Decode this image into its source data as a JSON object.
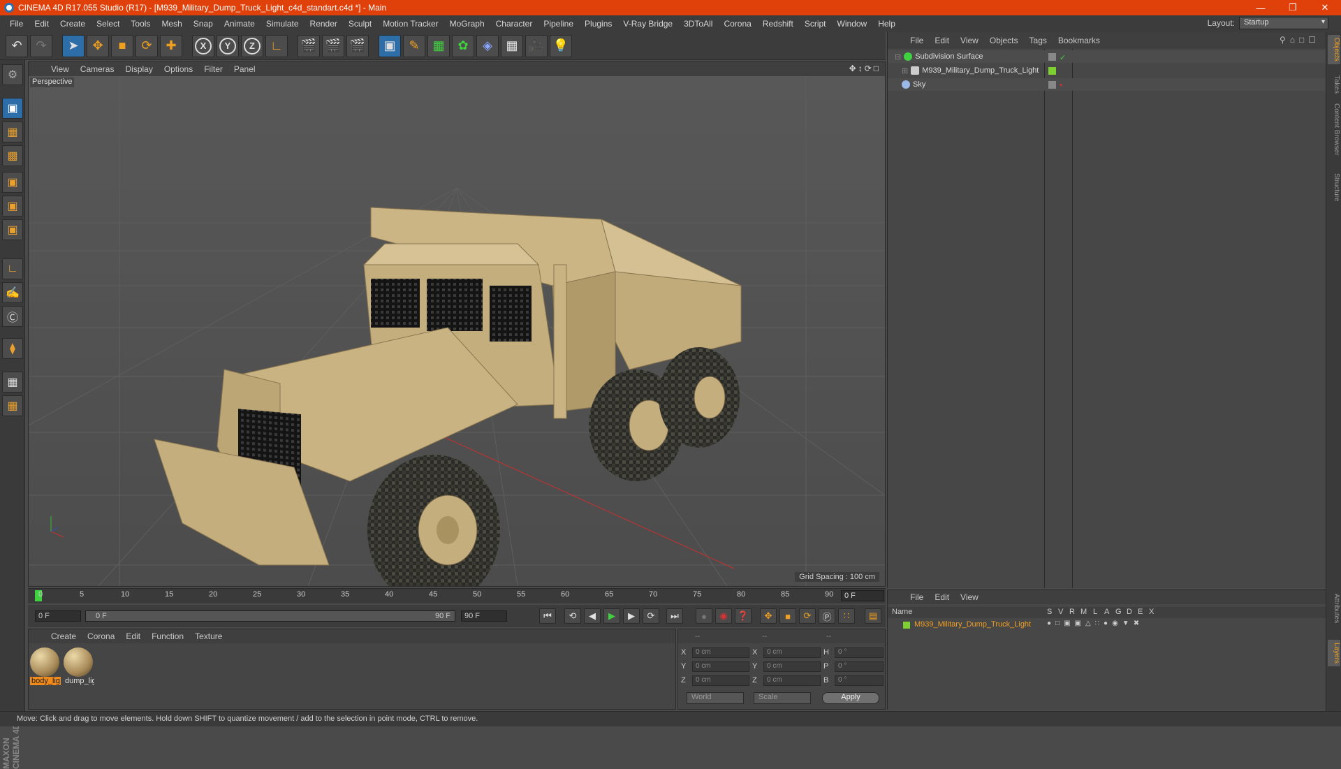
{
  "window": {
    "title": "CINEMA 4D R17.055 Studio (R17) - [M939_Military_Dump_Truck_Light_c4d_standart.c4d *] - Main",
    "minimize_icon": "minimize-icon",
    "restore_icon": "restore-icon",
    "close_icon": "close-icon"
  },
  "menubar": {
    "items": [
      "File",
      "Edit",
      "Create",
      "Select",
      "Tools",
      "Mesh",
      "Snap",
      "Animate",
      "Simulate",
      "Render",
      "Sculpt",
      "Motion Tracker",
      "MoGraph",
      "Character",
      "Pipeline",
      "Plugins",
      "V-Ray Bridge",
      "3DToAll",
      "Corona",
      "Redshift",
      "Script",
      "Window",
      "Help"
    ],
    "layout_label": "Layout:",
    "layout_value": "Startup"
  },
  "viewport": {
    "menu": [
      "View",
      "Cameras",
      "Display",
      "Options",
      "Filter",
      "Panel"
    ],
    "label": "Perspective",
    "grid_spacing": "Grid Spacing : 100 cm",
    "object_color": "#c9b382"
  },
  "timeline": {
    "ticks": [
      "0",
      "5",
      "10",
      "15",
      "20",
      "25",
      "30",
      "35",
      "40",
      "45",
      "50",
      "55",
      "60",
      "65",
      "70",
      "75",
      "80",
      "85",
      "90"
    ],
    "current_frame": "0 F"
  },
  "playbar": {
    "start_frame": "0 F",
    "range_start": "0 F",
    "range_end": "90 F",
    "end_frame": "90 F"
  },
  "material_manager": {
    "menu": [
      "Create",
      "Corona",
      "Edit",
      "Function",
      "Texture"
    ],
    "materials": [
      {
        "label": "body_lig"
      },
      {
        "label": "dump_lig"
      }
    ]
  },
  "coordinates": {
    "header": [
      "--",
      "--",
      "--"
    ],
    "rows": [
      {
        "a1": "X",
        "v1": "0 cm",
        "a2": "X",
        "v2": "0 cm",
        "a3": "H",
        "v3": "0 °"
      },
      {
        "a1": "Y",
        "v1": "0 cm",
        "a2": "Y",
        "v2": "0 cm",
        "a3": "P",
        "v3": "0 °"
      },
      {
        "a1": "Z",
        "v1": "0 cm",
        "a2": "Z",
        "v2": "0 cm",
        "a3": "B",
        "v3": "0 °"
      }
    ],
    "world": "World",
    "scale": "Scale",
    "apply": "Apply"
  },
  "object_manager": {
    "menu": [
      "File",
      "Edit",
      "View",
      "Objects",
      "Tags",
      "Bookmarks"
    ],
    "objects": [
      {
        "name": "Subdivision Surface"
      },
      {
        "name": "M939_Military_Dump_Truck_Light"
      },
      {
        "name": "Sky"
      }
    ]
  },
  "attribute_manager": {
    "menu": [
      "File",
      "Edit",
      "View"
    ],
    "columns": [
      "Name",
      "S",
      "V",
      "R",
      "M",
      "L",
      "A",
      "G",
      "D",
      "E",
      "X"
    ],
    "layer_name": "M939_Military_Dump_Truck_Light"
  },
  "right_tabs": [
    "Objects",
    "Takes",
    "Content Browser",
    "Structure",
    "Attributes",
    "Layers"
  ],
  "status": "Move: Click and drag to move elements. Hold down SHIFT to quantize movement / add to the selection in point mode, CTRL to remove.",
  "brand": "MAXON CINEMA 4D"
}
